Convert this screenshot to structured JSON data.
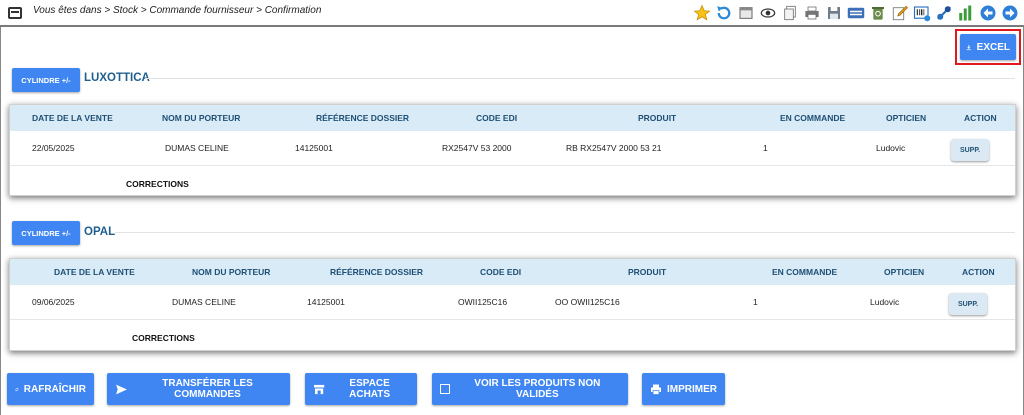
{
  "breadcrumb": "Vous êtes dans > Stock > Commande fournisseur > Confirmation",
  "toolbar_icons": [
    "star-icon",
    "refresh-history-icon",
    "window-icon",
    "eye-icon",
    "documents-icon",
    "printer-icon",
    "save-icon",
    "keyboard-icon",
    "recycle-icon",
    "edit-icon",
    "barcode-icon",
    "plug-icon",
    "bar-chart-icon",
    "arrow-left-icon",
    "arrow-right-icon"
  ],
  "excel_label": "EXCEL",
  "cylindre_label": "CYLINDRE +/-",
  "columns": [
    "DATE DE LA VENTE",
    "NOM DU PORTEUR",
    "RÉFÉRENCE DOSSIER",
    "CODE EDI",
    "PRODUIT",
    "EN COMMANDE",
    "OPTICIEN",
    "ACTION"
  ],
  "groups": [
    {
      "supplier": "LUXOTTICA",
      "rows": [
        {
          "date": "22/05/2025",
          "porteur": "DUMAS CELINE",
          "dossier": "14125001",
          "code_edi": "RX2547V 53 2000",
          "produit": "RB RX2547V 2000 53 21",
          "en_commande": "1",
          "opticien": "Ludovic",
          "action": "SUPP."
        }
      ],
      "corrections": "CORRECTIONS"
    },
    {
      "supplier": "OPAL",
      "rows": [
        {
          "date": "09/06/2025",
          "porteur": "DUMAS CELINE",
          "dossier": "14125001",
          "code_edi": "OWII125C16",
          "produit": "OO OWII125C16",
          "en_commande": "1",
          "opticien": "Ludovic",
          "action": "SUPP."
        }
      ],
      "corrections": "CORRECTIONS"
    }
  ],
  "actions": {
    "refresh": "RAFRAÎCHIR",
    "transfer": "TRANSFÉRER LES COMMANDES",
    "purchases": "ESPACE ACHATS",
    "unvalidated": "VOIR LES PRODUITS NON VALIDÉS",
    "print": "IMPRIMER"
  },
  "colors": {
    "primary": "#3f86f2",
    "header_bg": "#d8ebf6",
    "header_text": "#1f4f75",
    "supplier_text": "#1f5f8f",
    "excel_border": "#e0191f"
  }
}
